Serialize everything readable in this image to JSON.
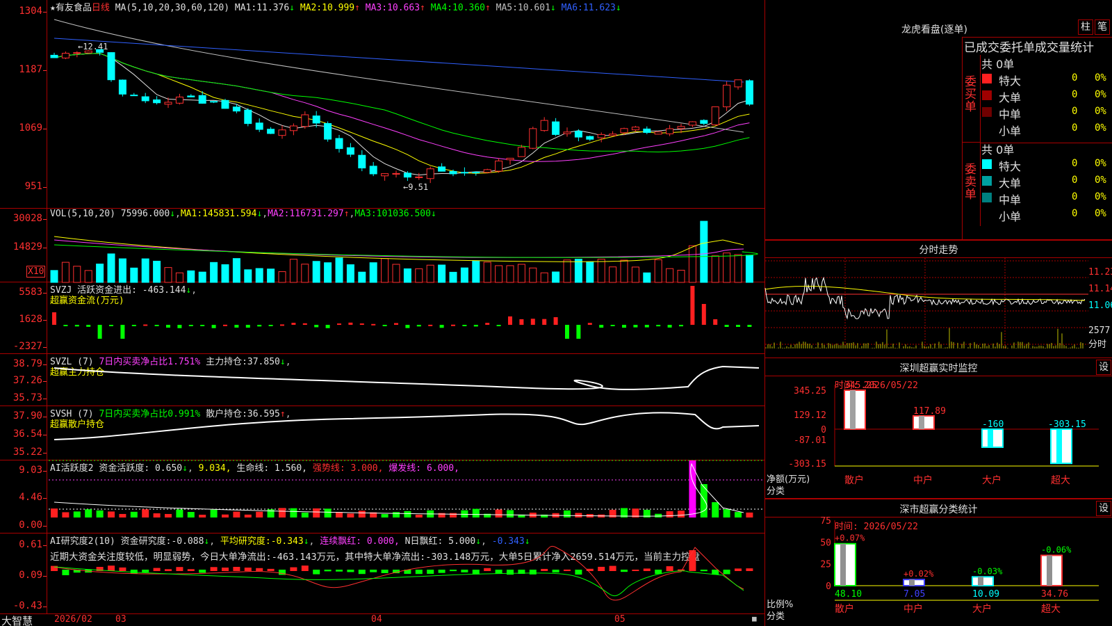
{
  "stock": {
    "name": "有友食品",
    "period": "日线",
    "ma_params": "MA(5,10,20,30,60,120)",
    "ma": [
      {
        "label": "MA1:",
        "value": "11.376",
        "arrow": "↓",
        "color": "#e0e0e0"
      },
      {
        "label": "MA2:",
        "value": "10.999",
        "arrow": "↑",
        "color": "#ffff00"
      },
      {
        "label": "MA3:",
        "value": "10.663",
        "arrow": "↑",
        "color": "#ff40ff"
      },
      {
        "label": "MA4:",
        "value": "10.360",
        "arrow": "↑",
        "color": "#00ff00"
      },
      {
        "label": "MA5:",
        "value": "10.601",
        "arrow": "↓",
        "color": "#c0c0c0"
      },
      {
        "label": "MA6:",
        "value": "11.623",
        "arrow": "↓",
        "color": "#3060ff"
      }
    ],
    "y_ticks": [
      "1304",
      "1187",
      "1069",
      "951"
    ],
    "high_label": "12.41",
    "low_label": "9.51",
    "star": "★"
  },
  "vol": {
    "header": "VOL(5,10,20)",
    "value": "75996.000",
    "ma1": "145831.594",
    "ma2": "116731.297",
    "ma3": "101036.500",
    "y_ticks": [
      "30028",
      "14829"
    ],
    "unit": "X10"
  },
  "svzj": {
    "header": "SVZJ  活跃资金进出:",
    "value": "-463.144",
    "sub": "超赢资金流(万元)",
    "y_ticks": [
      "5583",
      "1628",
      "-2327"
    ]
  },
  "svzl": {
    "header": "SVZL (7)",
    "ratio": "7日内买卖净占比1.751%",
    "label": "主力持仓:",
    "value": "37.850",
    "sub": "超赢主力持仓",
    "y_ticks": [
      "38.79",
      "37.26",
      "35.73"
    ]
  },
  "svsh": {
    "header": "SVSH (7)",
    "ratio": "7日内买卖净占比0.991%",
    "label": "散户持仓:",
    "value": "36.595",
    "sub": "超赢散户持仓",
    "y_ticks": [
      "37.90",
      "36.54",
      "35.22"
    ]
  },
  "ai2": {
    "header": "AI活跃度2",
    "l1": "资金活跃度:",
    "v1": "0.650",
    "v2": "9.034,",
    "l3": "生命线:",
    "v3": "1.560,",
    "l4": "强势线:",
    "v4": "3.000,",
    "l5": "爆发线:",
    "v5": "6.000,",
    "y_ticks": [
      "9.03",
      "4.46",
      "0.00"
    ]
  },
  "ai_research": {
    "header": "AI研究度2(10)",
    "l1": "资金研究度:",
    "v1": "-0.088",
    "l2": "平均研究度:",
    "v2": "-0.343",
    "l3": "连续飘红:",
    "v3": "0.000,",
    "l4": "N日飘红:",
    "v4": "5.000",
    "v5": "-0.343",
    "desc": "近期大资金关注度较低，明显弱势，今日大单净流出:-463.143万元，其中特大单净流出:-303.148万元，大单5日累计净入2659.514万元，当前主力控盘",
    "y_ticks": [
      "0.61",
      "0.09",
      "-0.43"
    ]
  },
  "footer": {
    "brand": "大智慧",
    "dates": [
      "2026/02",
      "03",
      "04",
      "05"
    ]
  },
  "dragon": {
    "title": "龙虎看盘(逐单)",
    "btn1": "柱",
    "btn2": "笔",
    "subtitle": "已成交委托单成交量统计",
    "buy": {
      "side": "委买单",
      "total": "共 0单",
      "rows": [
        {
          "name": "特大",
          "count": "0",
          "pct": "0%",
          "color": "#ff2020"
        },
        {
          "name": "大单",
          "count": "0",
          "pct": "0%",
          "color": "#a00000"
        },
        {
          "name": "中单",
          "count": "0",
          "pct": "0%",
          "color": "#700000"
        },
        {
          "name": "小单",
          "count": "0",
          "pct": "0%",
          "color": "#000"
        }
      ]
    },
    "sell": {
      "side": "委卖单",
      "total": "共 0单",
      "rows": [
        {
          "name": "特大",
          "count": "0",
          "pct": "0%",
          "color": "#00ffff"
        },
        {
          "name": "大单",
          "count": "0",
          "pct": "0%",
          "color": "#00a0a0"
        },
        {
          "name": "中单",
          "count": "0",
          "pct": "0%",
          "color": "#008080"
        },
        {
          "name": "小单",
          "count": "0",
          "pct": "0%",
          "color": "#000"
        }
      ]
    }
  },
  "intraday": {
    "title": "分时走势",
    "y_ticks": [
      "11.23",
      "11.14",
      "11.06"
    ],
    "vol_label": "2577",
    "unit": "分时"
  },
  "monitor": {
    "title": "深圳超赢实时监控",
    "btn": "设",
    "time": "时间: 2026/05/22",
    "y_ticks": [
      "345.25",
      "129.12",
      "0",
      "-87.01",
      "-303.15"
    ],
    "ylabel": "净额(万元)",
    "xlabel": "分类",
    "bars": [
      {
        "cat": "散户",
        "value": 345.25,
        "label": "345.25"
      },
      {
        "cat": "中户",
        "value": 117.89,
        "label": "117.89"
      },
      {
        "cat": "大户",
        "value": -160,
        "label": "-160"
      },
      {
        "cat": "超大",
        "value": -303.15,
        "label": "-303.15"
      }
    ]
  },
  "classify": {
    "title": "深市超赢分类统计",
    "btn": "设",
    "time": "时间: 2026/05/22",
    "y_ticks": [
      "75",
      "50",
      "25",
      "0"
    ],
    "ylabel": "比例%",
    "xlabel": "分类",
    "bars": [
      {
        "cat": "散户",
        "value": 48.1,
        "label": "48.10",
        "chg": "+0.07%"
      },
      {
        "cat": "中户",
        "value": 7.05,
        "label": "7.05",
        "chg": "+0.02%"
      },
      {
        "cat": "大户",
        "value": 10.09,
        "label": "10.09",
        "chg": "-0.03%"
      },
      {
        "cat": "超大",
        "value": 34.76,
        "label": "34.76",
        "chg": "-0.06%"
      }
    ]
  }
}
